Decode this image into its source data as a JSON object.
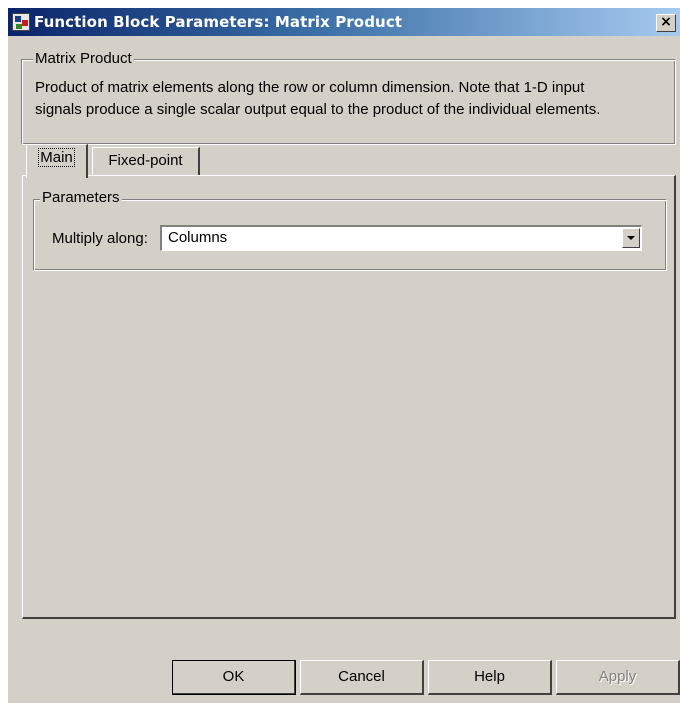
{
  "window": {
    "title": "Function Block Parameters: Matrix Product",
    "close_glyph": "×"
  },
  "block": {
    "group_title": "Matrix Product",
    "description_line1": "Product of matrix elements along the row or column dimension. Note that 1-D input",
    "description_line2": "signals produce a single scalar output equal to the product of the individual elements."
  },
  "tabs": [
    {
      "label": "Main",
      "active": true
    },
    {
      "label": "Fixed-point",
      "active": false
    }
  ],
  "parameters": {
    "group_title": "Parameters",
    "multiply_along_label": "Multiply along:",
    "multiply_along_value": "Columns"
  },
  "buttons": {
    "ok": "OK",
    "cancel": "Cancel",
    "help": "Help",
    "apply": "Apply"
  },
  "icons": {
    "app": "simulink-block-icon",
    "close": "close-icon",
    "dropdown": "chevron-down-icon"
  },
  "colors": {
    "dialog_face": "#d4d0c8",
    "title_start": "#0a246a",
    "title_end": "#a6caf0",
    "disabled_text": "#808080"
  }
}
